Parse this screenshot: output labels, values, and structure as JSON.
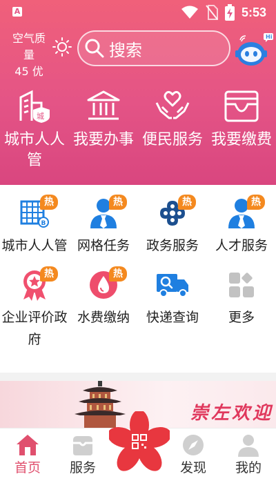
{
  "status_bar": {
    "time": "5:53",
    "left_icon": "A",
    "icons": [
      "wifi-icon",
      "no-sim-icon",
      "battery-charging-icon"
    ]
  },
  "header": {
    "air_quality": [
      "空气质",
      "量",
      "45 优"
    ],
    "weather_icon": "sun-icon",
    "search_placeholder": "搜索",
    "assistant_badge": "Hi"
  },
  "quick_actions": [
    {
      "label": "城市人人管",
      "icon": "city-building-icon"
    },
    {
      "label": "我要办事",
      "icon": "government-hall-icon"
    },
    {
      "label": "便民服务",
      "icon": "heart-hands-icon"
    },
    {
      "label": "我要缴费",
      "icon": "wallet-icon"
    }
  ],
  "services": [
    {
      "label": "城市人人管",
      "icon": "grid-building-icon",
      "hot": true
    },
    {
      "label": "网格任务",
      "icon": "person-tie-icon",
      "hot": true
    },
    {
      "label": "政务服务",
      "icon": "knot-icon",
      "hot": true
    },
    {
      "label": "人才服务",
      "icon": "person-tie-icon",
      "hot": true
    },
    {
      "label": "企业评价政府",
      "icon": "award-ribbon-icon",
      "hot": true
    },
    {
      "label": "水费缴纳",
      "icon": "water-drop-icon",
      "hot": true
    },
    {
      "label": "快递查询",
      "icon": "delivery-truck-icon",
      "hot": false
    },
    {
      "label": "更多",
      "icon": "more-apps-icon",
      "hot": false
    }
  ],
  "hot_badge": "热",
  "banner": {
    "text": "崇左欢迎"
  },
  "tabbar": [
    {
      "label": "首页",
      "icon": "home-icon",
      "active": true
    },
    {
      "label": "服务",
      "icon": "service-icon",
      "active": false
    },
    {
      "label": "",
      "icon": "scan-qr-icon",
      "active": false
    },
    {
      "label": "发现",
      "icon": "compass-icon",
      "active": false
    },
    {
      "label": "我的",
      "icon": "user-icon",
      "active": false
    }
  ],
  "colors": {
    "header_top": "#f0607a",
    "header_bottom": "#d9467f",
    "service_blue": "#1f7fe0",
    "hot_orange": "#f4891f",
    "accent_pink": "#e0385d"
  }
}
